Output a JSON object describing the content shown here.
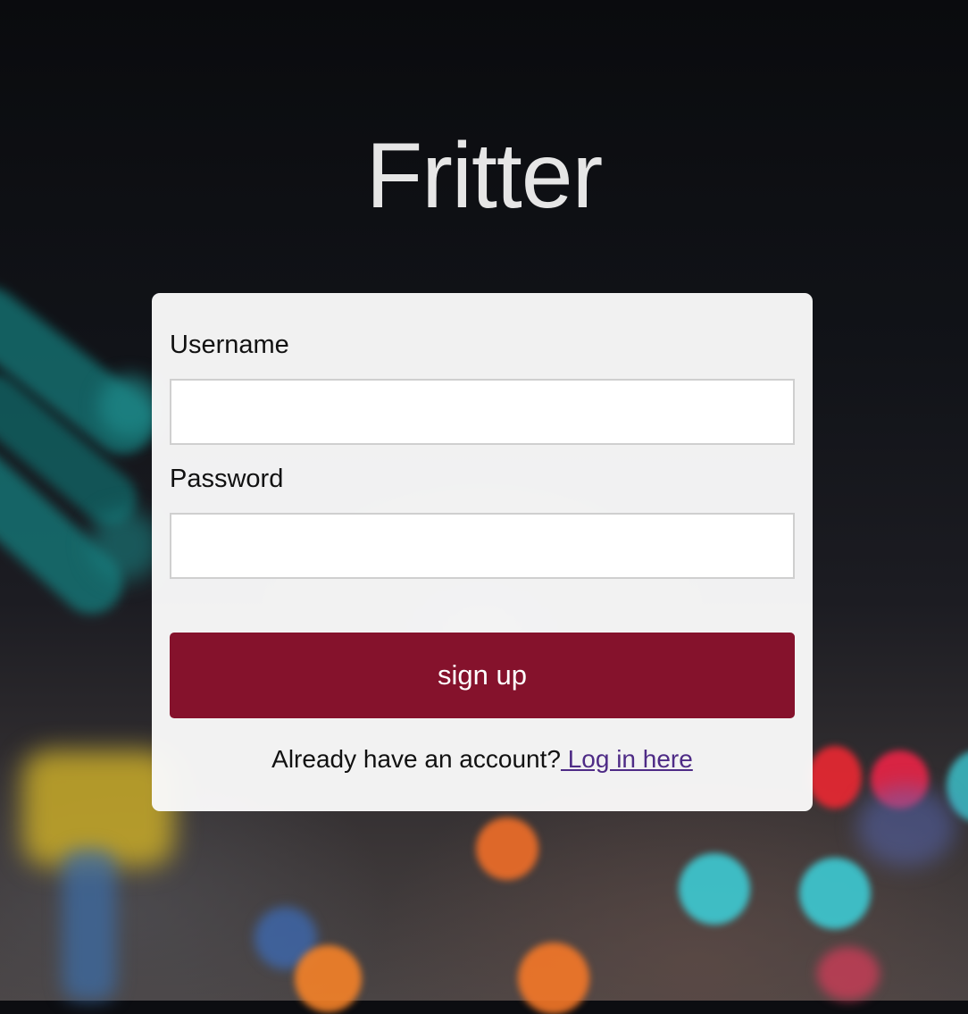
{
  "app": {
    "title": "Fritter"
  },
  "signup_form": {
    "username_label": "Username",
    "username_value": "",
    "password_label": "Password",
    "password_value": "",
    "submit_label": "sign up",
    "footer_text": "Already have an account?",
    "login_link_text": " Log in here"
  },
  "colors": {
    "submit_button": "#85122c",
    "link": "#4e2b86",
    "title": "#e6e6e6",
    "card": "#f9f9f9"
  }
}
